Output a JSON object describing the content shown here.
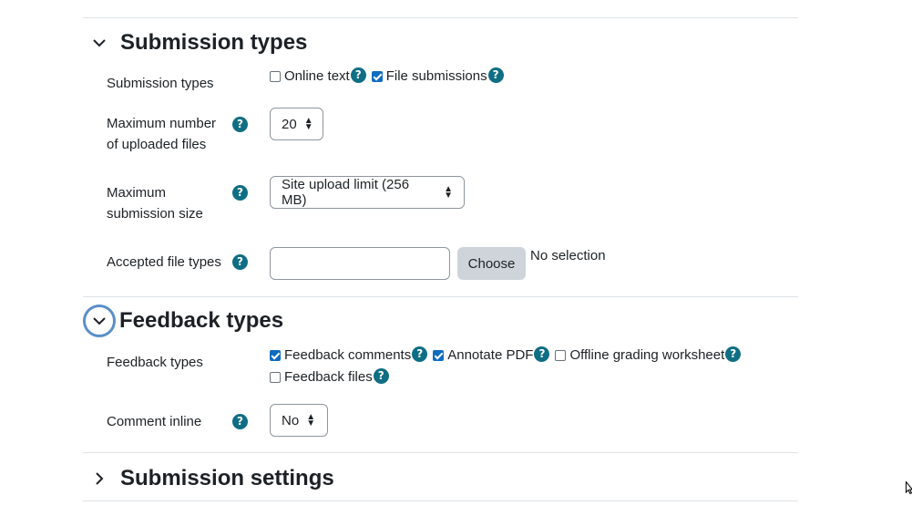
{
  "submission_types_section": {
    "title": "Submission types",
    "field_label": "Submission types",
    "options": [
      {
        "label": "Online text",
        "checked": false
      },
      {
        "label": "File submissions",
        "checked": true
      }
    ]
  },
  "max_files": {
    "label_line1": "Maximum number",
    "label_line2": "of uploaded files",
    "value": "20"
  },
  "max_size": {
    "label_line1": "Maximum",
    "label_line2": "submission size",
    "value": "Site upload limit (256 MB)"
  },
  "accepted_file_types": {
    "label": "Accepted file types",
    "input_value": "",
    "choose_label": "Choose",
    "selection_text": "No selection"
  },
  "feedback_types_section": {
    "title": "Feedback types",
    "field_label": "Feedback types",
    "options": [
      {
        "label": "Feedback comments",
        "checked": true
      },
      {
        "label": "Annotate PDF",
        "checked": true
      },
      {
        "label": "Offline grading worksheet",
        "checked": false
      },
      {
        "label": "Feedback files",
        "checked": false
      }
    ]
  },
  "comment_inline": {
    "label": "Comment inline",
    "value": "No"
  },
  "submission_settings_section": {
    "title": "Submission settings"
  },
  "help_icon_glyph": "?",
  "colors": {
    "accent": "#0f6cbf",
    "help_icon": "#0f6e84",
    "focus_ring": "#5b8fc7"
  }
}
